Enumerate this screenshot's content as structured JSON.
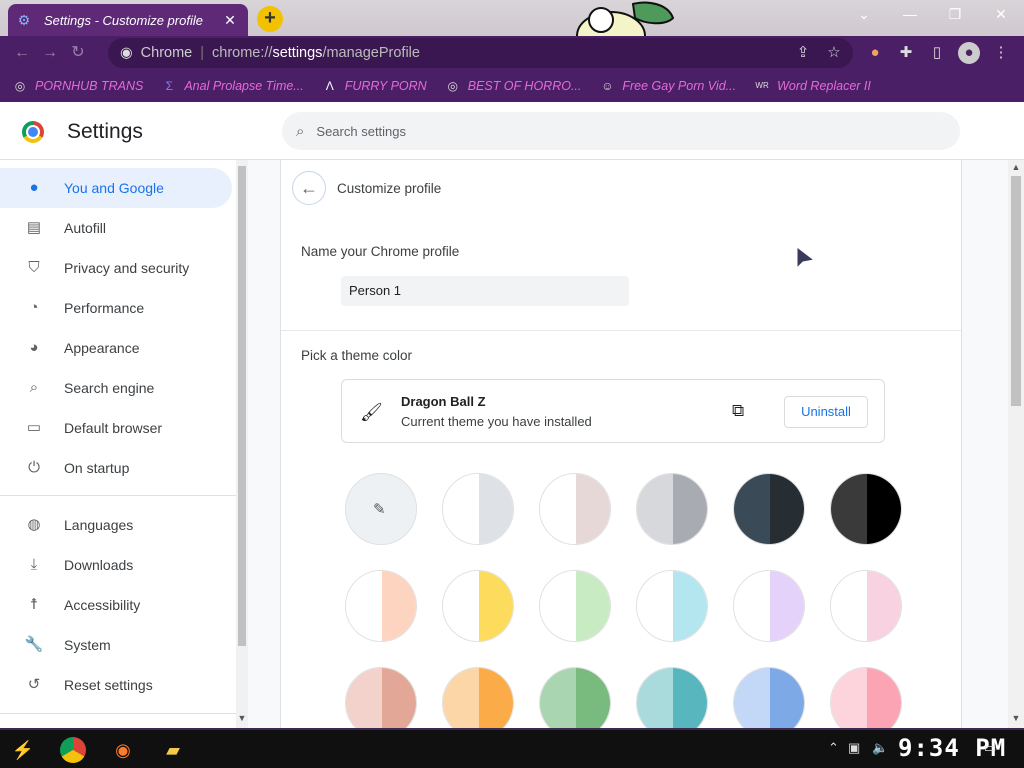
{
  "browser": {
    "tab_title": "Settings - Customize profile",
    "omnibox_chip": "Chrome",
    "url_prefix": "chrome://",
    "url_host": "settings",
    "url_path": "/manageProfile"
  },
  "bookmarks": [
    {
      "label": "PORNHUB TRANS"
    },
    {
      "label": "Anal Prolapse Time..."
    },
    {
      "label": "FURRY PORN"
    },
    {
      "label": "BEST OF HORRO..."
    },
    {
      "label": "Free Gay Porn Vid..."
    },
    {
      "label": "Word Replacer II"
    }
  ],
  "settings": {
    "title": "Settings",
    "search_placeholder": "Search settings"
  },
  "sidebar": {
    "items": [
      {
        "label": "You and Google",
        "icon": "person-icon"
      },
      {
        "label": "Autofill",
        "icon": "clipboard-icon"
      },
      {
        "label": "Privacy and security",
        "icon": "shield-icon"
      },
      {
        "label": "Performance",
        "icon": "speedometer-icon"
      },
      {
        "label": "Appearance",
        "icon": "palette-icon"
      },
      {
        "label": "Search engine",
        "icon": "search-icon"
      },
      {
        "label": "Default browser",
        "icon": "browser-icon"
      },
      {
        "label": "On startup",
        "icon": "power-icon"
      },
      {
        "label": "Languages",
        "icon": "globe-icon"
      },
      {
        "label": "Downloads",
        "icon": "download-icon"
      },
      {
        "label": "Accessibility",
        "icon": "accessibility-icon"
      },
      {
        "label": "System",
        "icon": "wrench-icon"
      },
      {
        "label": "Reset settings",
        "icon": "reset-icon"
      }
    ]
  },
  "profile": {
    "subpage_title": "Customize profile",
    "name_label": "Name your Chrome profile",
    "name_value": "Person 1",
    "theme_label": "Pick a theme color",
    "theme_name": "Dragon Ball Z",
    "theme_desc": "Current theme you have installed",
    "uninstall_label": "Uninstall"
  },
  "swatch_colors": [
    [
      "#ffffff",
      "#dee1e6"
    ],
    [
      "#ffffff",
      "#e6d8d6"
    ],
    [
      "#d6d8dc",
      "#a8abb1"
    ],
    [
      "#3a4a56",
      "#262e33"
    ],
    [
      "#3a3a3a",
      "#000000"
    ],
    [
      "#ffffff",
      "#fdd4c0"
    ],
    [
      "#ffffff",
      "#fddb5c"
    ],
    [
      "#ffffff",
      "#c9ebc4"
    ],
    [
      "#ffffff",
      "#b3e6ef"
    ],
    [
      "#ffffff",
      "#e4d2fb"
    ],
    [
      "#ffffff",
      "#f8d2e1"
    ],
    [
      "#f2d2cb",
      "#e3a797"
    ],
    [
      "#fcd6a6",
      "#fbab48"
    ],
    [
      "#a9d6b1",
      "#79ba7e"
    ],
    [
      "#a9dadc",
      "#57b6be"
    ],
    [
      "#c3d7f6",
      "#7ea9e7"
    ],
    [
      "#fdd4dc",
      "#fba4b4"
    ]
  ],
  "taskbar": {
    "clock": "9:34 PM"
  }
}
